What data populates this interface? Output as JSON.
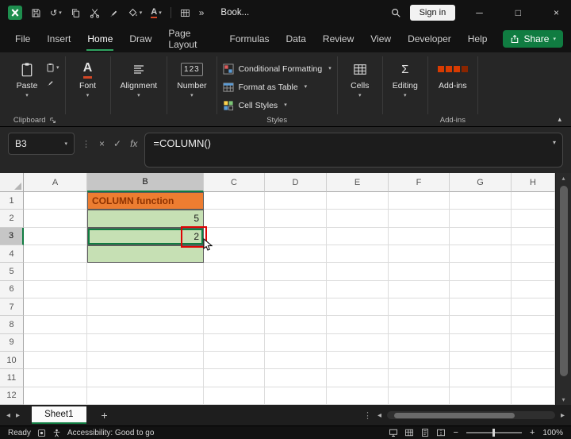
{
  "glyphs": {
    "chevron_down": "▾",
    "chevron_up": "▴",
    "undo": "↺",
    "more": "»",
    "vertical_dots": "⋮",
    "cancel": "×",
    "enter": "✓",
    "minimize": "─",
    "maximize": "□",
    "close": "×",
    "nav_left": "◂",
    "nav_right": "▸",
    "add_sheet": "+",
    "zoom_out": "−",
    "zoom_in": "+",
    "letter_a": "A",
    "number_icon": "123",
    "sigma": "Σ"
  },
  "titlebar": {
    "workbook_name": "Book...",
    "sign_in_label": "Sign in"
  },
  "menubar": {
    "items": [
      "File",
      "Insert",
      "Home",
      "Draw",
      "Page Layout",
      "Formulas",
      "Data",
      "Review",
      "View",
      "Developer",
      "Help"
    ],
    "active_item": "Home",
    "share_label": "Share"
  },
  "ribbon": {
    "paste_label": "Paste",
    "clipboard_group_label": "Clipboard",
    "font_label": "Font",
    "alignment_label": "Alignment",
    "number_label": "Number",
    "conditional_formatting_label": "Conditional Formatting",
    "format_as_table_label": "Format as Table",
    "cell_styles_label": "Cell Styles",
    "styles_group_label": "Styles",
    "cells_label": "Cells",
    "editing_label": "Editing",
    "addins_label": "Add-ins",
    "addins_group_label": "Add-ins"
  },
  "formula_bar": {
    "name_box_value": "B3",
    "formula": "=COLUMN()",
    "fx_label": "fx"
  },
  "grid": {
    "columns": [
      "A",
      "B",
      "C",
      "D",
      "E",
      "F",
      "G",
      "H"
    ],
    "rows": [
      "1",
      "2",
      "3",
      "4",
      "5",
      "6",
      "7",
      "8",
      "9",
      "10",
      "11",
      "12"
    ],
    "selected_column": "B",
    "selected_row": "3",
    "active_cell": "B3",
    "annotation_color": "#DD0404",
    "cells": [
      {
        "ref": "B1",
        "text": "COLUMN function",
        "fill": "#ED7D31",
        "text_color": "#8F3200",
        "bold": true,
        "align": "left",
        "bordered": true
      },
      {
        "ref": "B2",
        "text": "5",
        "fill": "#C6E0B4",
        "align": "right",
        "bordered": true
      },
      {
        "ref": "B3",
        "text": "2",
        "fill": "#C6E0B4",
        "align": "right",
        "bordered": true,
        "active": true,
        "annotated": true
      },
      {
        "ref": "B4",
        "text": "",
        "fill": "#C6E0B4",
        "bordered": true
      }
    ]
  },
  "sheet_bar": {
    "tabs": [
      {
        "label": "Sheet1",
        "active": true
      }
    ]
  },
  "status_bar": {
    "mode": "Ready",
    "accessibility_status": "Accessibility: Good to go",
    "zoom_level": "100%"
  }
}
